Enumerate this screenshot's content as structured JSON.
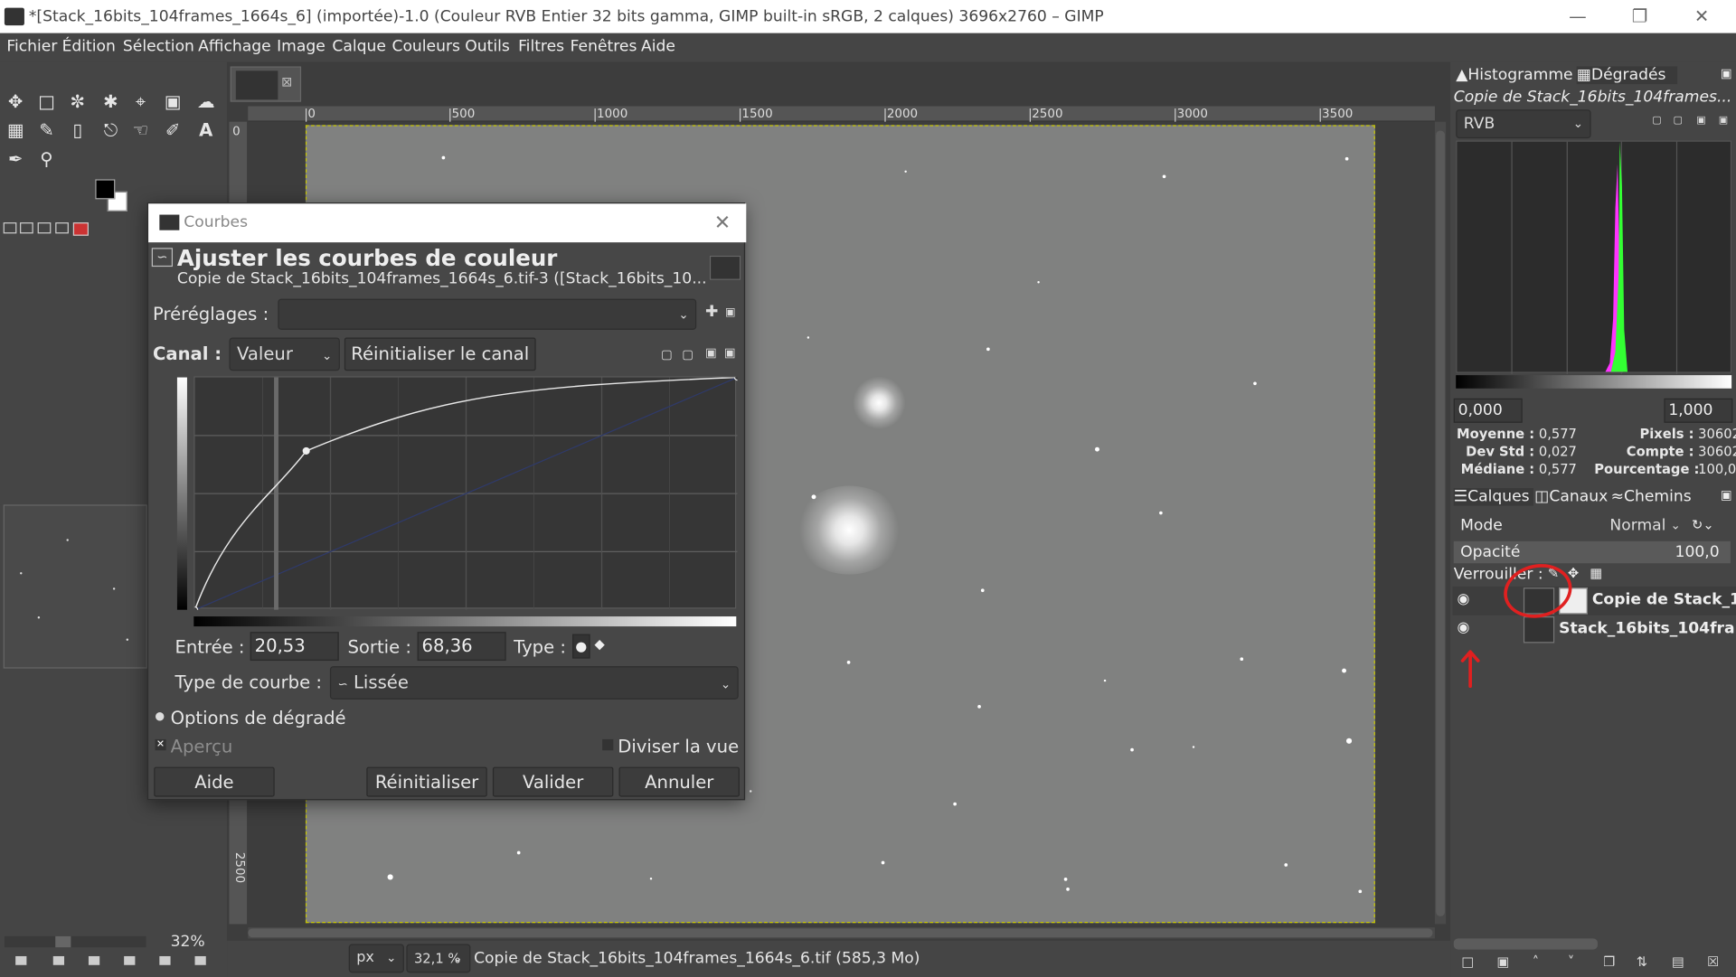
{
  "window": {
    "title": "*[Stack_16bits_104frames_1664s_6] (importée)-1.0 (Couleur RVB Entier 32 bits gamma, GIMP built-in sRGB, 2 calques) 3696x2760 – GIMP"
  },
  "menu": [
    "Fichier",
    "Édition",
    "Sélection",
    "Affichage",
    "Image",
    "Calque",
    "Couleurs",
    "Outils",
    "Filtres",
    "Fenêtres",
    "Aide"
  ],
  "toolbox": {
    "zoom_label": "32%"
  },
  "ruler": {
    "labels": [
      "0",
      "500",
      "1000",
      "1500",
      "2000",
      "2500",
      "3000",
      "3500"
    ],
    "v_labels": [
      "0",
      "2500"
    ]
  },
  "status": {
    "unit": "px",
    "zoom": "32,1 %",
    "info": "Copie de Stack_16bits_104frames_1664s_6.tif (585,3 Mo)"
  },
  "dialog": {
    "window_title": "Courbes",
    "heading": "Ajuster les courbes de couleur",
    "subheading": "Copie de Stack_16bits_104frames_1664s_6.tif-3 ([Stack_16bits_10...",
    "presets_label": "Préréglages :",
    "presets_value": "",
    "channel_label": "Canal :",
    "channel_value": "Valeur",
    "reset_channel": "Réinitialiser le canal",
    "input_label": "Entrée :",
    "input_value": "20,53",
    "output_label": "Sortie :",
    "output_value": "68,36",
    "type_label": "Type :",
    "curve_type_label": "Type de courbe :",
    "curve_type_value": "Lissée",
    "blend_options": "Options de dégradé",
    "preview": "Aperçu",
    "split_view": "Diviser la vue",
    "btn_help": "Aide",
    "btn_reset": "Réinitialiser",
    "btn_ok": "Valider",
    "btn_cancel": "Annuler",
    "curve_points": [
      [
        0,
        0
      ],
      [
        20.53,
        68.36
      ],
      [
        100,
        100
      ]
    ]
  },
  "histogram": {
    "tab1": "Histogramme",
    "tab2": "Dégradés",
    "image_name": "Copie de Stack_16bits_104frames...",
    "channel": "RVB",
    "range_min": "0,000",
    "range_max": "1,000",
    "stats_left": [
      {
        "label": "Moyenne :",
        "value": "0,577"
      },
      {
        "label": "Dev Std :",
        "value": "0,027"
      },
      {
        "label": "Médiane :",
        "value": "0,577"
      }
    ],
    "stats_right": [
      {
        "label": "Pixels :",
        "value": "30602"
      },
      {
        "label": "Compte :",
        "value": "30602"
      },
      {
        "label": "Pourcentage :",
        "value": "100,0"
      }
    ],
    "peak_colors": [
      "#ff33ff",
      "#33ff33"
    ]
  },
  "layers": {
    "tab1": "Calques",
    "tab2": "Canaux",
    "tab3": "Chemins",
    "mode_label": "Mode",
    "mode_value": "Normal",
    "opacity_label": "Opacité",
    "opacity_value": "100,0",
    "lock_label": "Verrouiller :",
    "items": [
      {
        "name": "Copie de Stack_1",
        "visible": true
      },
      {
        "name": "Stack_16bits_104fra",
        "visible": true
      }
    ]
  },
  "annotation_color": "#e02020"
}
